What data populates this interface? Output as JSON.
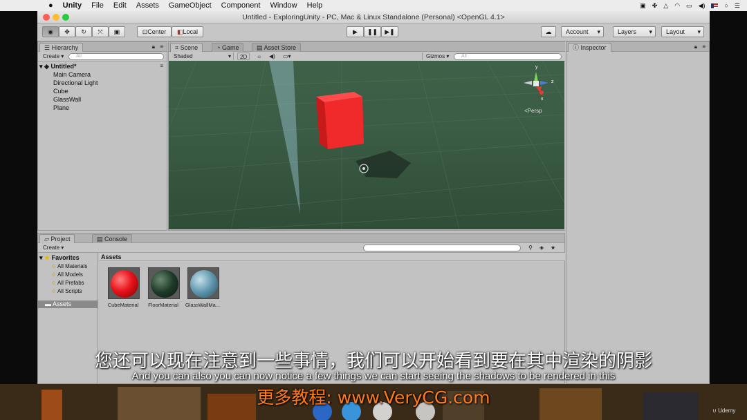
{
  "menubar": {
    "apple": "",
    "app": "Unity",
    "items": [
      "File",
      "Edit",
      "Assets",
      "GameObject",
      "Component",
      "Window",
      "Help"
    ]
  },
  "window": {
    "title": "Untitled - ExploringUnity - PC, Mac & Linux Standalone (Personal) <OpenGL 4.1>"
  },
  "toolbar": {
    "pivot": "Center",
    "space": "Local",
    "account": "Account",
    "layers": "Layers",
    "layout": "Layout"
  },
  "hierarchy": {
    "tab": "Hierarchy",
    "create": "Create",
    "search_placeholder": "All",
    "scene_name": "Untitled*",
    "objects": [
      "Main Camera",
      "Directional Light",
      "Cube",
      "GlassWall",
      "Plane"
    ]
  },
  "scene_view": {
    "tabs": [
      "Scene",
      "Game",
      "Asset Store"
    ],
    "shading": "Shaded",
    "mode_2d": "2D",
    "gizmos": "Gizmos",
    "search_placeholder": "All",
    "gizmo_axes": [
      "y",
      "z",
      "x"
    ],
    "projection": "Persp"
  },
  "inspector": {
    "tab": "Inspector"
  },
  "project": {
    "tabs": [
      "Project",
      "Console"
    ],
    "create": "Create",
    "favorites_label": "Favorites",
    "favorites": [
      "All Materials",
      "All Models",
      "All Prefabs",
      "All Scripts"
    ],
    "assets_folder": "Assets",
    "assets_header": "Assets",
    "assets": [
      {
        "name": "CubeMaterial",
        "color": "#e8141c"
      },
      {
        "name": "FloorMaterial",
        "color": "#1f3a28"
      },
      {
        "name": "GlassWallMa...",
        "color": "#5f96ad"
      }
    ]
  },
  "subtitles": {
    "chinese": "您还可以现在注意到一些事情，我们可以开始看到要在其中渲染的阴影",
    "english": "And you can also you can now notice a few things we can start seeing the shadows to be rendered in this",
    "watermark": "更多教程: www.VeryCG.com",
    "udemy": "Udemy"
  }
}
